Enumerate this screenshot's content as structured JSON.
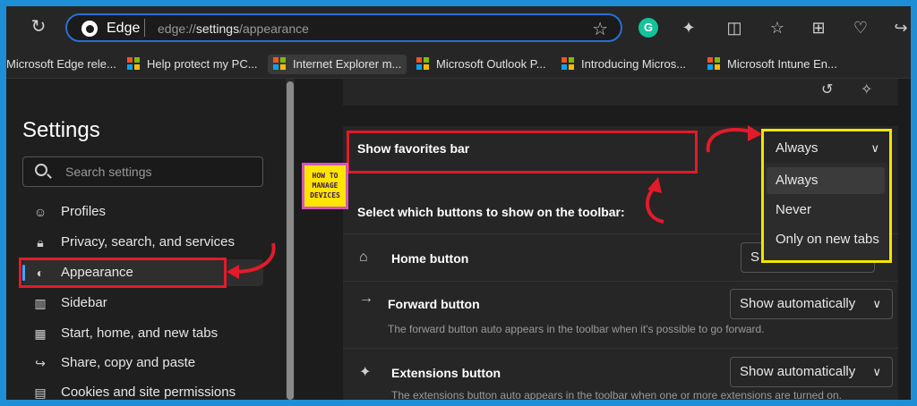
{
  "browser": {
    "site_label": "Edge",
    "url_prefix": "edge://",
    "url_bold": "settings",
    "url_rest": "/appearance"
  },
  "favorites": [
    {
      "label": "Microsoft Edge rele..."
    },
    {
      "label": "Help protect my PC..."
    },
    {
      "label": "Internet Explorer m..."
    },
    {
      "label": "Microsoft Outlook P..."
    },
    {
      "label": "Introducing Micros..."
    },
    {
      "label": "Microsoft Intune En..."
    }
  ],
  "sidebar": {
    "title": "Settings",
    "search_placeholder": "Search settings",
    "items": [
      {
        "label": "Profiles",
        "icon": "profile-icon"
      },
      {
        "label": "Privacy, search, and services",
        "icon": "lock-icon"
      },
      {
        "label": "Appearance",
        "icon": "palette-icon",
        "selected": true
      },
      {
        "label": "Sidebar",
        "icon": "sidebar-icon"
      },
      {
        "label": "Start, home, and new tabs",
        "icon": "home-icon"
      },
      {
        "label": "Share, copy and paste",
        "icon": "share-icon"
      },
      {
        "label": "Cookies and site permissions",
        "icon": "cookie-icon"
      }
    ]
  },
  "content": {
    "favorites_bar_label": "Show favorites bar",
    "favorites_bar_value": "Always",
    "dropdown_options": [
      "Always",
      "Never",
      "Only on new tabs"
    ],
    "toolbar_heading": "Select which buttons to show on the toolbar:",
    "home_button_label": "Home button",
    "home_button_value": "S",
    "forward_button_label": "Forward button",
    "forward_button_value": "Show automatically",
    "forward_button_desc": "The forward button auto appears in the toolbar when it's possible to go forward.",
    "extensions_button_label": "Extensions button",
    "extensions_button_value": "Show automatically",
    "extensions_button_desc": "The extensions button auto appears in the toolbar when one or more extensions are turned on."
  },
  "watermark": {
    "line1": "HOW TO",
    "line2": "MANAGE",
    "line3": "DEVICES"
  },
  "colors": {
    "highlight_red": "#e21b2a",
    "highlight_yellow": "#f2e500",
    "accent_blue": "#2a6fd6"
  }
}
